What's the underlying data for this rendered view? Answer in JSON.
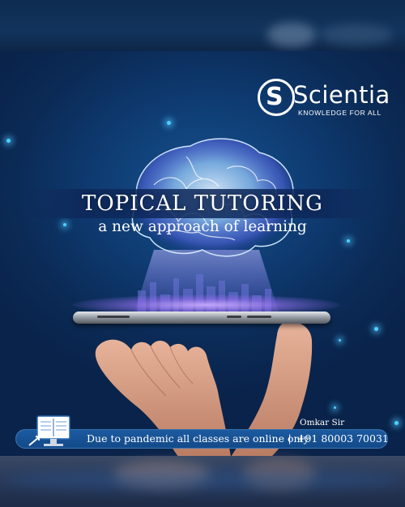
{
  "brand": {
    "name": "Scientia",
    "tagline": "KNOWLEDGE FOR ALL",
    "mark_letter": "S"
  },
  "headline": {
    "title": "TOPICAL TUTORING",
    "subtitle": "a new approach of learning"
  },
  "footer": {
    "signature": "Omkar Sir",
    "message": "Due to pandemic all classes are online only",
    "separator": "|",
    "phone": "+91 80003 70031"
  },
  "icons": [
    "scientia-logo-icon",
    "brain-icon",
    "smartphone-icon",
    "hand-icon",
    "online-book-icon"
  ],
  "colors": {
    "background": "#0b2a55",
    "accent_glow": "#4ed0ff",
    "footer_bar": "#1c5aa0",
    "text": "#ffffff"
  }
}
